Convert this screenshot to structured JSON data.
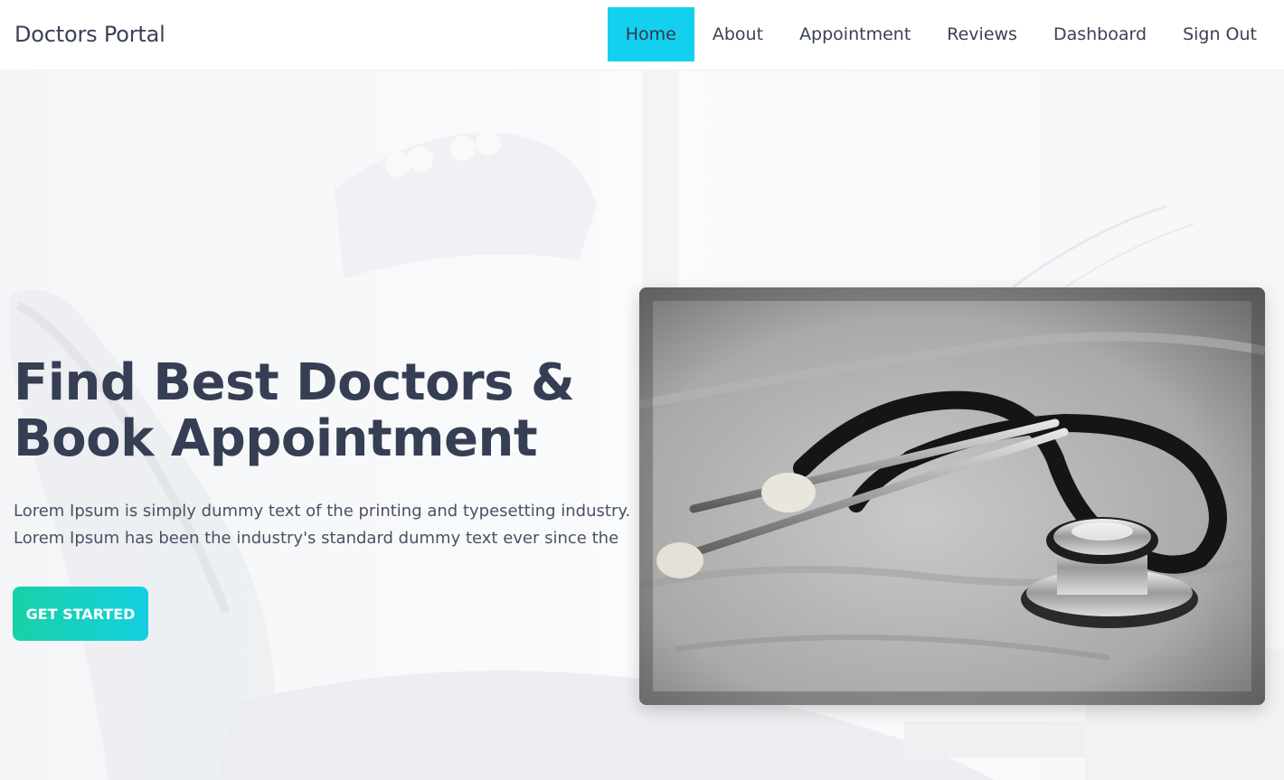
{
  "brand": "Doctors Portal",
  "nav": {
    "items": [
      {
        "label": "Home",
        "active": true
      },
      {
        "label": "About",
        "active": false
      },
      {
        "label": "Appointment",
        "active": false
      },
      {
        "label": "Reviews",
        "active": false
      },
      {
        "label": "Dashboard",
        "active": false
      },
      {
        "label": "Sign Out",
        "active": false
      }
    ]
  },
  "hero": {
    "title_line1": "Find Best Doctors &",
    "title_line2": "Book Appointment",
    "desc_line1": "Lorem Ipsum is simply dummy text of the printing and typesetting industry.",
    "desc_line2": "Lorem Ipsum has been the industry's standard dummy text ever since the",
    "cta_label": "GET STARTED",
    "image_icon": "stethoscope-photo"
  },
  "colors": {
    "accent": "#13d0ef",
    "cta_start": "#19d1a6",
    "cta_end": "#14cfe0",
    "text": "#363e53"
  }
}
